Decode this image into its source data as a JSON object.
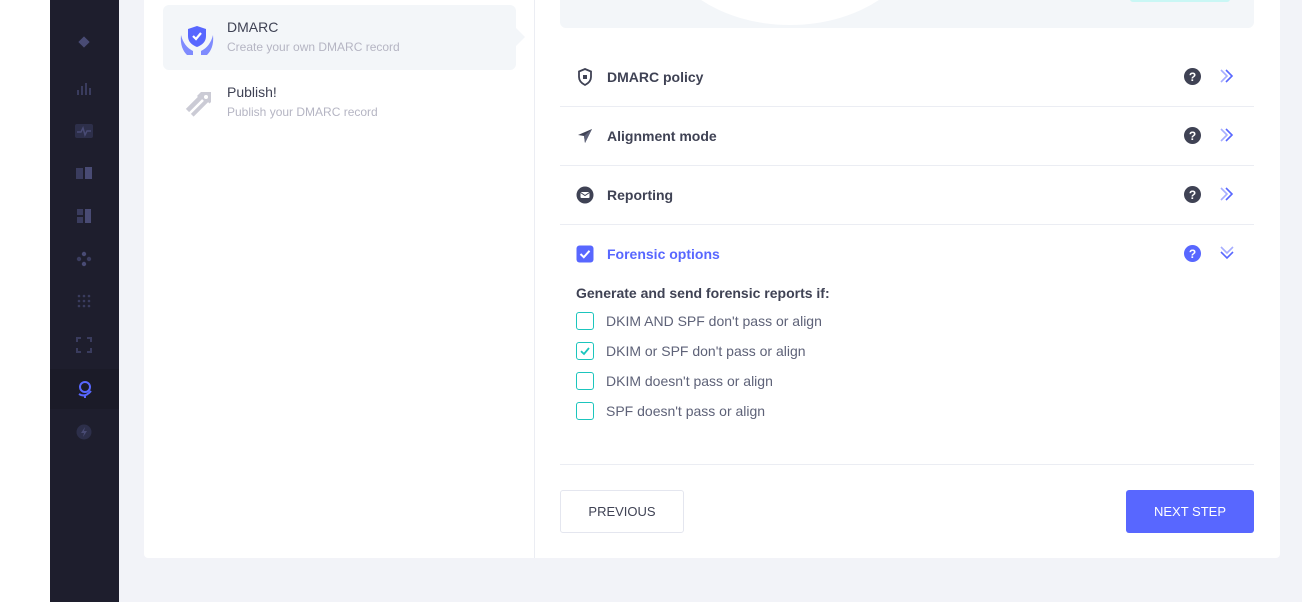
{
  "colors": {
    "sidebar_bg": "#1e1e2d",
    "accent": "#5867ff",
    "checkbox": "#1bc5bd",
    "text_dark": "#3f4254",
    "text_muted": "#b5b5c3"
  },
  "sidebar": {
    "items": [
      {
        "icon": "diamond-icon"
      },
      {
        "icon": "bar-chart-icon"
      },
      {
        "icon": "pulse-icon"
      },
      {
        "icon": "book-icon"
      },
      {
        "icon": "layout-icon"
      },
      {
        "icon": "nodes-icon"
      },
      {
        "icon": "grid-dots-icon"
      },
      {
        "icon": "scan-icon"
      },
      {
        "icon": "globe-icon",
        "active": true
      },
      {
        "icon": "bolt-icon"
      }
    ]
  },
  "steps": [
    {
      "title": "DMARC",
      "desc": "Create your own DMARC record",
      "icon": "shield-hands-icon",
      "active": true
    },
    {
      "title": "Publish!",
      "desc": "Publish your DMARC record",
      "icon": "tag-stripes-icon",
      "active": false
    }
  ],
  "accordion": [
    {
      "label": "DMARC policy",
      "icon": "shield-icon",
      "expanded": false
    },
    {
      "label": "Alignment mode",
      "icon": "compass-icon",
      "expanded": false
    },
    {
      "label": "Reporting",
      "icon": "mail-circle-icon",
      "expanded": false
    },
    {
      "label": "Forensic options",
      "icon": "checkbox-checked-icon",
      "expanded": true
    }
  ],
  "forensic": {
    "title": "Generate and send forensic reports if:",
    "options": [
      {
        "label": "DKIM AND SPF don't pass or align",
        "checked": false
      },
      {
        "label": "DKIM or SPF don't pass or align",
        "checked": true
      },
      {
        "label": "DKIM doesn't pass or align",
        "checked": false
      },
      {
        "label": "SPF doesn't pass or align",
        "checked": false
      }
    ]
  },
  "buttons": {
    "previous": "PREVIOUS",
    "next": "NEXT STEP"
  },
  "help_glyph": "?"
}
